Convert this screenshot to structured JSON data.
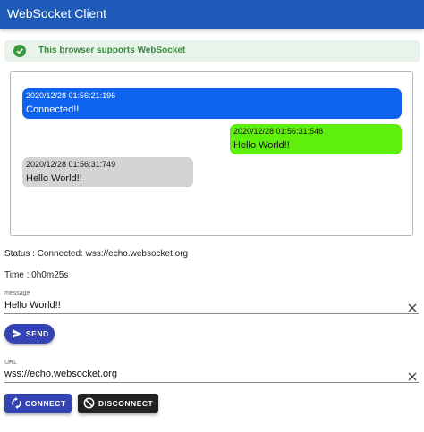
{
  "appbar": {
    "title": "WebSocket Client"
  },
  "alert": {
    "text": "This browser supports WebSocket",
    "icon": "check-circle-icon",
    "color": "#3a9a3f"
  },
  "messages": [
    {
      "timestamp": "2020/12/28 01:56:21:196",
      "text": "Connected!!",
      "color": "#0d62f0"
    },
    {
      "timestamp": "2020/12/28 01:56:31:548",
      "text": "Hello World!!",
      "color": "#5ef00a"
    },
    {
      "timestamp": "2020/12/28 01:56:31:749",
      "text": "Hello World!!",
      "color": "#d4d4d4"
    }
  ],
  "status": "Status : Connected: wss://echo.websocket.org",
  "time": "Time : 0h0m25s",
  "message_field": {
    "label": "message",
    "value": "Hello World!!"
  },
  "send_button": {
    "label": "SEND",
    "icon": "send-icon"
  },
  "url_field": {
    "label": "URL",
    "value": "wss://echo.websocket.org"
  },
  "connect_button": {
    "label": "CONNECT",
    "icon": "sync-icon"
  },
  "disconnect_button": {
    "label": "DISCONNECT",
    "icon": "block-icon"
  },
  "colors": {
    "appbar": "#1e5bb8",
    "primary_button": "#3444b4",
    "disconnect_button": "#222222"
  }
}
